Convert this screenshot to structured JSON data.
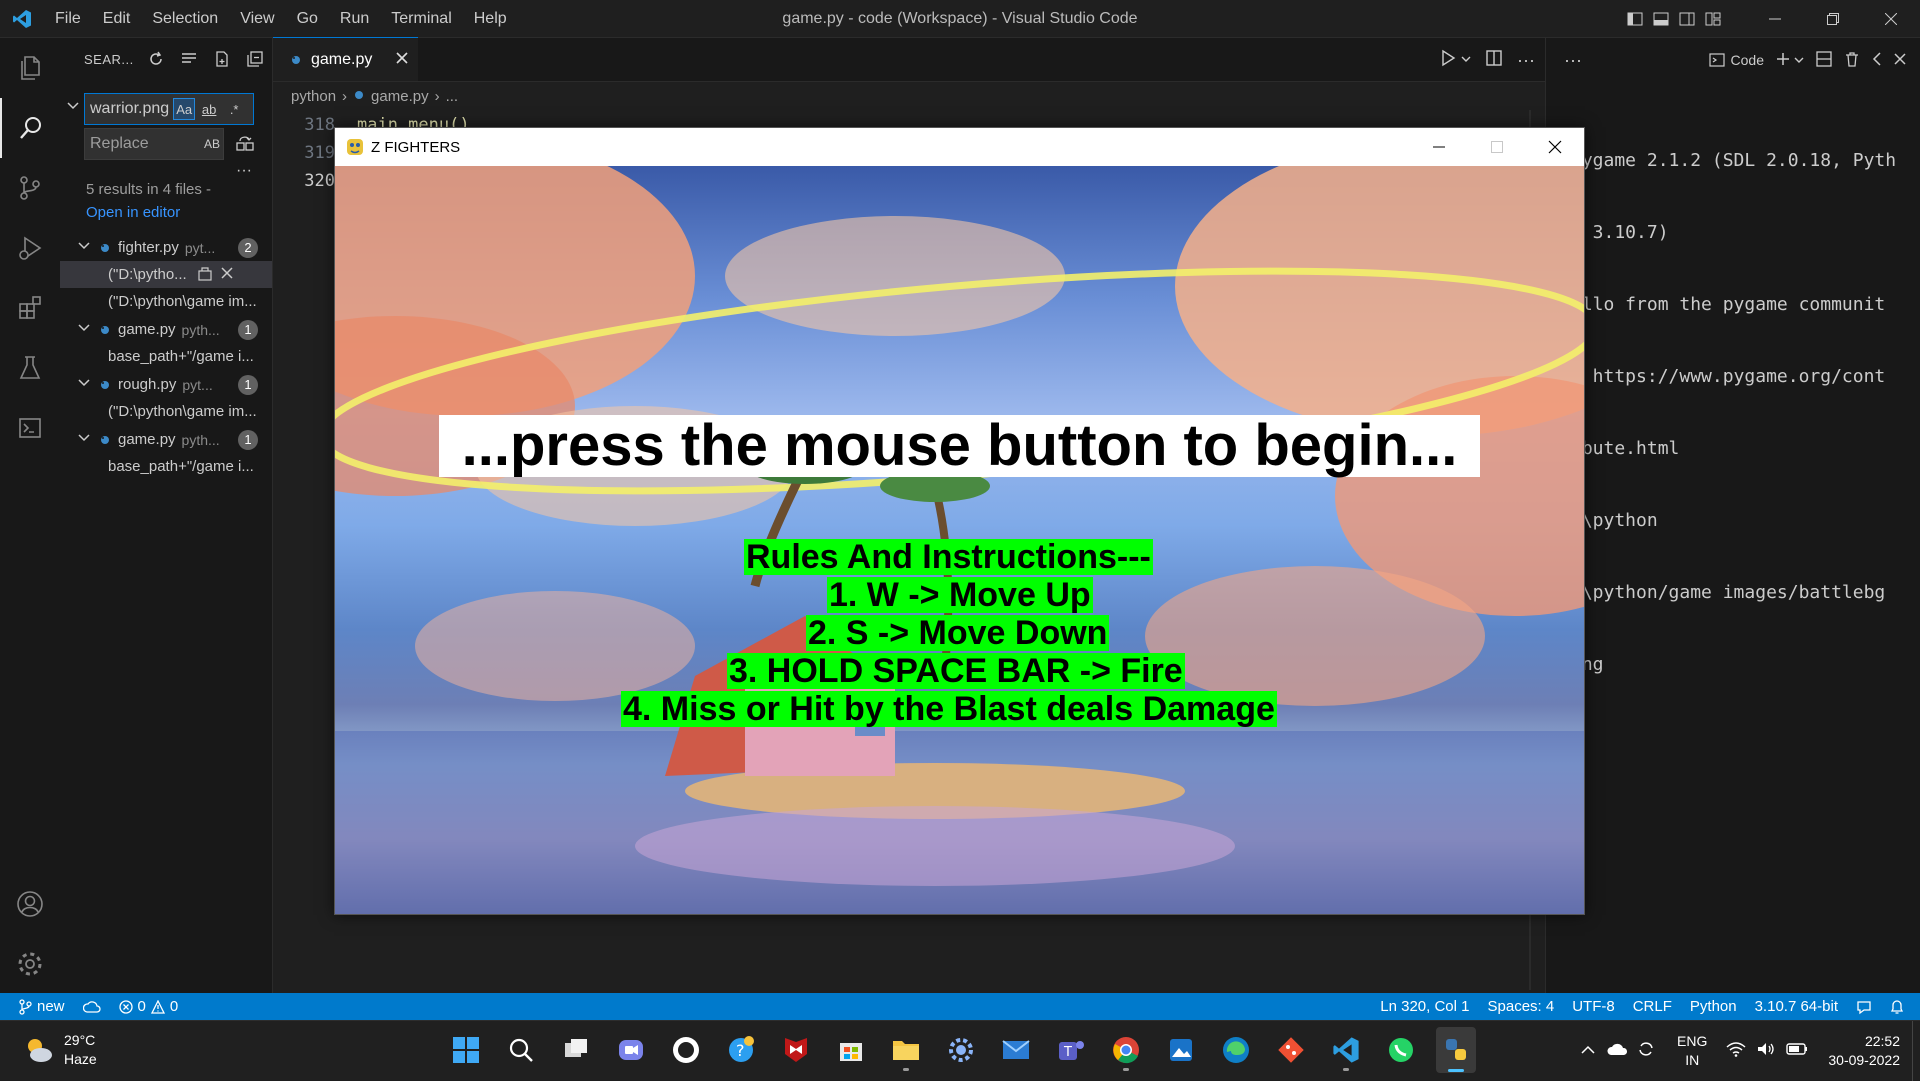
{
  "titlebar": {
    "menu": [
      "File",
      "Edit",
      "Selection",
      "View",
      "Go",
      "Run",
      "Terminal",
      "Help"
    ],
    "window_title": "game.py - code (Workspace) - Visual Studio Code"
  },
  "sidebar": {
    "header": "SEAR...",
    "search_value": "warrior.png",
    "match_case": "Aa",
    "whole_word": "ab",
    "regex": ".*",
    "replace_placeholder": "Replace",
    "replace_all": "AB",
    "results_summary": "5 results in 4 files -",
    "open_in_editor": "Open in editor",
    "results": [
      {
        "file": "fighter.py",
        "path": "pyt...",
        "count": "2",
        "matches": [
          "(\"D:\\pytho...",
          "(\"D:\\python\\game im..."
        ]
      },
      {
        "file": "game.py",
        "path": "pyth...",
        "count": "1",
        "matches": [
          "base_path+\"/game i..."
        ]
      },
      {
        "file": "rough.py",
        "path": "pyt...",
        "count": "1",
        "matches": [
          "(\"D:\\python\\game im..."
        ]
      },
      {
        "file": "game.py",
        "path": "pyth...",
        "count": "1",
        "matches": [
          "base_path+\"/game i..."
        ]
      }
    ]
  },
  "editor": {
    "tab_label": "game.py",
    "breadcrumb": [
      "python",
      "game.py",
      "..."
    ],
    "lines": [
      {
        "num": "318",
        "text": "main_menu()"
      },
      {
        "num": "319",
        "text": ""
      },
      {
        "num": "320",
        "text": ""
      }
    ]
  },
  "panel": {
    "terminal_label": "Code",
    "output": [
      "pygame 2.1.2 (SDL 2.0.18, Pyth",
      "n 3.10.7)",
      "ello from the pygame communit",
      ". https://www.pygame.org/cont",
      "ibute.html",
      ":\\python",
      ":\\python/game images/battlebg",
      "png"
    ]
  },
  "statusbar": {
    "branch": "new",
    "errors": "0",
    "warnings": "0",
    "position": "Ln 320, Col 1",
    "spaces": "Spaces: 4",
    "encoding": "UTF-8",
    "eol": "CRLF",
    "language": "Python",
    "interpreter": "3.10.7 64-bit"
  },
  "game": {
    "window_title": "Z FIGHTERS",
    "prompt": "...press the mouse button to begin...",
    "rules": [
      "Rules And Instructions---",
      "1. W -> Move Up",
      "2. S -> Move Down",
      "3. HOLD SPACE BAR -> Fire",
      "4. Miss or Hit by the Blast deals Damage"
    ]
  },
  "taskbar": {
    "temperature": "29°C",
    "condition": "Haze",
    "lang_line1": "ENG",
    "lang_line2": "IN",
    "time": "22:52",
    "date": "30-09-2022"
  },
  "colors": {
    "accent": "#007acc",
    "rules_highlight": "#00ff00",
    "python_icon": "#3c8ac8"
  }
}
